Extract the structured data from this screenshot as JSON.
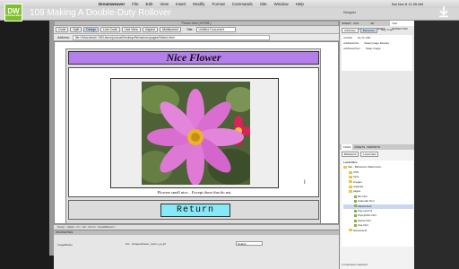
{
  "video": {
    "logo_text": "DW",
    "logo_sub": "infiniteskills",
    "title": "109 Making A Double-Duty Rollover"
  },
  "menubar": {
    "items": [
      "Dreamweaver",
      "File",
      "Edit",
      "View",
      "Insert",
      "Modify",
      "Format",
      "Commands",
      "Site",
      "Window",
      "Help"
    ],
    "clock": "Sat Nov 8  11:35 AM"
  },
  "app": {
    "workspace": "Designer",
    "document_title": "Flower.html (XHTML)"
  },
  "toolbar": {
    "code": "Code",
    "split": "Split",
    "design": "Design",
    "live_code": "Live Code",
    "live_view": "Live View",
    "inspect": "Inspect",
    "multiscreen": "Multiscreen",
    "title_label": "Title:",
    "title_value": "Untitled Document"
  },
  "address": {
    "label": "Address:",
    "url": "file:///Macintosh HD/Users/joshua/Desktop/Behaviors/pages/Select.html"
  },
  "page": {
    "heading": "Nice Flower",
    "caption": "Flowers smell nice... Except those that do not.",
    "button": "Return"
  },
  "statusbar": {
    "path": "<body> <table> <tr> <td> <form> <input#Return>"
  },
  "properties": {
    "title": "PROPERTIES",
    "image_label": "ImageButton",
    "src": "Src  ../images/flower_return_up.gif",
    "align_value": "Default"
  },
  "panels": {
    "tabs": [
      "INSERT",
      "CSS STYLES",
      "AP ELEMENTS",
      "TAG INSPECTOR"
    ],
    "attrs_btn": "Attributes",
    "behaviors_btn": "Behaviors",
    "tag_label": "Tag <img>",
    "behaviors": [
      {
        "event": "onClick",
        "action": "Go To URL"
      },
      {
        "event": "onMouseOut",
        "action": "Swap Image Restore"
      },
      {
        "event": "onMouseOver",
        "action": "Swap Image"
      }
    ],
    "files_tabs": [
      "FILES",
      "ASSETS",
      "SNIPPETS"
    ],
    "site_select": "Behaviors",
    "view_select": "Local view",
    "files": [
      {
        "name": "Local Files",
        "type": "header"
      },
      {
        "name": "Site - Behaviors (Macintosh...",
        "type": "folder"
      },
      {
        "name": "CSS",
        "type": "folder"
      },
      {
        "name": "fonts",
        "type": "folder"
      },
      {
        "name": "images",
        "type": "folder"
      },
      {
        "name": "originals",
        "type": "folder"
      },
      {
        "name": "pages",
        "type": "folder"
      },
      {
        "name": "Bio.html",
        "type": "file"
      },
      {
        "name": "Calendar.html",
        "type": "file"
      },
      {
        "name": "Flower.html",
        "type": "file"
      },
      {
        "name": "Pop-up.html",
        "type": "file"
      },
      {
        "name": "PopUpWin.html",
        "type": "file"
      },
      {
        "name": "Select.html",
        "type": "file"
      },
      {
        "name": "Use.html",
        "type": "file"
      },
      {
        "name": "SpryAssets",
        "type": "folder"
      }
    ],
    "files_status": "1 local items selected"
  },
  "colors": {
    "header_bg": "#b47fe8",
    "button_bg": "#86e9f5",
    "logo_green": "#7cc02c"
  }
}
